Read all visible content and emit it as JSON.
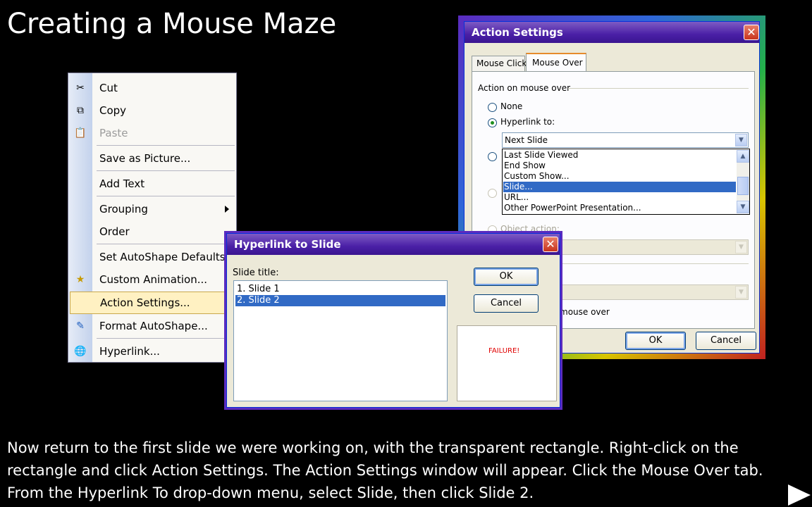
{
  "slide": {
    "title": "Creating a Mouse Maze",
    "caption": "Now return to the first slide we were working on, with the transparent rectangle. Right-click on the rectangle and click Action Settings. The Action Settings window will appear. Click the Mouse Over tab. From the  Hyperlink To drop-down menu, select Slide, then click Slide 2."
  },
  "context_menu": {
    "items": [
      {
        "label": "Cut",
        "icon": "scissors-icon"
      },
      {
        "label": "Copy",
        "icon": "copy-icon"
      },
      {
        "label": "Paste",
        "icon": "paste-icon"
      },
      {
        "label": "Save as Picture..."
      },
      {
        "label": "Add Text"
      },
      {
        "label": "Grouping"
      },
      {
        "label": "Order"
      },
      {
        "label": "Set AutoShape Defaults"
      },
      {
        "label": "Custom Animation...",
        "icon": "animation-icon"
      },
      {
        "label": "Action Settings..."
      },
      {
        "label": "Format AutoShape...",
        "icon": "format-icon"
      },
      {
        "label": "Hyperlink...",
        "icon": "hyperlink-icon"
      }
    ]
  },
  "action_settings": {
    "title": "Action Settings",
    "tabs": [
      "Mouse Click",
      "Mouse Over"
    ],
    "group_label": "Action on mouse over",
    "none_label": "None",
    "hyperlink_label": "Hyperlink to:",
    "hyperlink_value": "Next Slide",
    "dropdown_options": [
      "Last Slide Viewed",
      "End Show",
      "Custom Show...",
      "Slide...",
      "URL...",
      "Other PowerPoint Presentation..."
    ],
    "selected_option": "Slide...",
    "object_action_label": "Object action:",
    "highlight_label": "mouse over",
    "ok_label": "OK",
    "cancel_label": "Cancel"
  },
  "hyperlink_to_slide": {
    "title": "Hyperlink to Slide",
    "slide_title_label": "Slide title:",
    "slides": [
      "1. Slide 1",
      "2. Slide 2"
    ],
    "selected_slide": "2. Slide 2",
    "ok_label": "OK",
    "cancel_label": "Cancel",
    "preview_text": "FAILURE!"
  },
  "colors": {
    "title_bar": "#4a1fa6",
    "selection": "#316ac5",
    "menu_highlight": "#fff1c2",
    "failure_text": "#e00000"
  }
}
